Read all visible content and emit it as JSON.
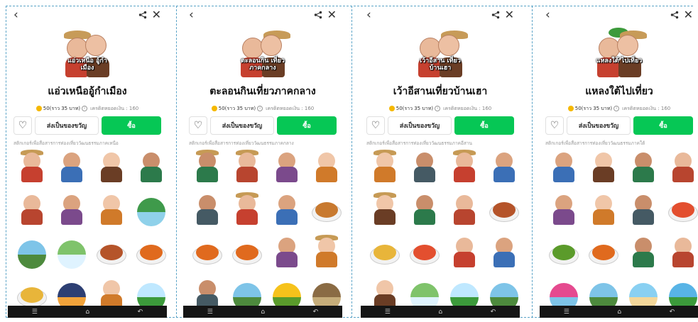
{
  "accent": "#06c755",
  "panels": [
    {
      "hero_label": "แอ่วเหนือ อู้กำเมือง",
      "title": "แอ่วเหนืออู้กำเมือง",
      "price": "50(ราว 35 บาท)",
      "price_note": "เครดิตหยอดเงิน : 160",
      "gift_label": "ส่งเป็นของขวัญ",
      "buy_label": "ซื้อ",
      "description": "สติกเกอร์เพื่อสื่อสารการท่องเที่ยววัฒนธรรมภาคเหนือ"
    },
    {
      "hero_label": "ตะลอนกิน เที่ยวภาคกลาง",
      "title": "ตะลอนกินเที่ยวภาคกลาง",
      "price": "50(ราว 35 บาท)",
      "price_note": "เครดิตหยอดเงิน : 160",
      "gift_label": "ส่งเป็นของขวัญ",
      "buy_label": "ซื้อ",
      "description": "สติกเกอร์เพื่อสื่อสารการท่องเที่ยววัฒนธรรมภาคกลาง"
    },
    {
      "hero_label": "เว้าอีสาน เที่ยวบ้านเฮา",
      "title": "เว้าอีสานเที่ยวบ้านเฮา",
      "price": "50(ราว 35 บาท)",
      "price_note": "เครดิตหยอดเงิน : 160",
      "gift_label": "ส่งเป็นของขวัญ",
      "buy_label": "ซื้อ",
      "description": "สติกเกอร์เพื่อสื่อสารการท่องเที่ยววัฒนธรรมภาคอีสาน"
    },
    {
      "hero_label": "แหลงใต้ ไปเที่ยว",
      "title": "แหลงใต้ไปเที่ยว",
      "price": "50(ราว 35 บาท)",
      "price_note": "เครดิตหยอดเงิน : 160",
      "gift_label": "ส่งเป็นของขวัญ",
      "buy_label": "ซื้อ",
      "description": "สติกเกอร์เพื่อสื่อสารการท่องเที่ยววัฒนธรรมภาคใต้"
    }
  ],
  "sticker_rows": [
    [
      [
        "person-hat",
        "person",
        "person",
        "person"
      ],
      [
        "person",
        "person",
        "person",
        "scene-waterfall"
      ],
      [
        "scene-river",
        "scene-mountain",
        "food-sausage",
        "food-curry"
      ],
      [
        "food-noodle",
        "scene-lantern",
        "person",
        "scene-palm"
      ]
    ],
    [
      [
        "person-hat",
        "person-hat",
        "person",
        "person"
      ],
      [
        "person",
        "person-hat",
        "person",
        "food-fish"
      ],
      [
        "food-curry",
        "food-curry",
        "person",
        "person-hat"
      ],
      [
        "person",
        "scene-river",
        "scene-sunflower",
        "scene-rock"
      ]
    ],
    [
      [
        "person-hat",
        "person",
        "person-hat",
        "person"
      ],
      [
        "person-hat",
        "person",
        "person",
        "food-sausage"
      ],
      [
        "food-noodle",
        "food-salad",
        "person",
        "person"
      ],
      [
        "person",
        "scene-mountain",
        "scene-palm",
        "scene-river"
      ]
    ],
    [
      [
        "person",
        "person",
        "person",
        "person"
      ],
      [
        "person",
        "person",
        "person",
        "food-salad"
      ],
      [
        "food-veg",
        "food-curry",
        "person",
        "person"
      ],
      [
        "scene-boat",
        "scene-river",
        "scene-beach",
        "scene-island"
      ]
    ]
  ]
}
